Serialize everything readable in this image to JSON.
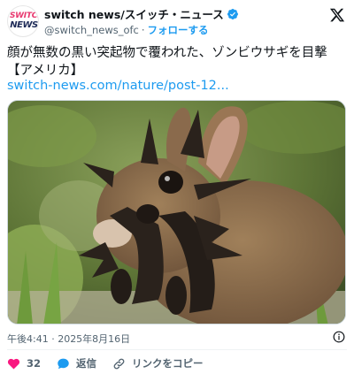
{
  "account": {
    "avatar_logo_top": "SWITCH",
    "avatar_logo_bottom": "NEWS",
    "display_name": "switch news/スイッチ・ニュース",
    "handle": "@switch_news_ofc",
    "separator": "·",
    "follow_label": "フォローする"
  },
  "tweet": {
    "text": "顔が無数の黒い突起物で覆われた、ゾンビウサギを目撃【アメリカ】",
    "link": "switch-news.com/nature/post-12..."
  },
  "meta": {
    "timestamp": "午後4:41 · 2025年8月16日"
  },
  "actions": {
    "like_count": "32",
    "reply_label": "返信",
    "copy_link_label": "リンクをコピー"
  },
  "colors": {
    "accent": "#1d9bf0",
    "like": "#f91880",
    "text": "#0f1419",
    "secondary": "#536471"
  },
  "icons": {
    "verified": "verified-badge-icon",
    "platform": "x-logo-icon",
    "info": "info-icon",
    "like": "heart-icon",
    "reply": "speech-bubble-icon",
    "copy_link": "link-icon"
  }
}
